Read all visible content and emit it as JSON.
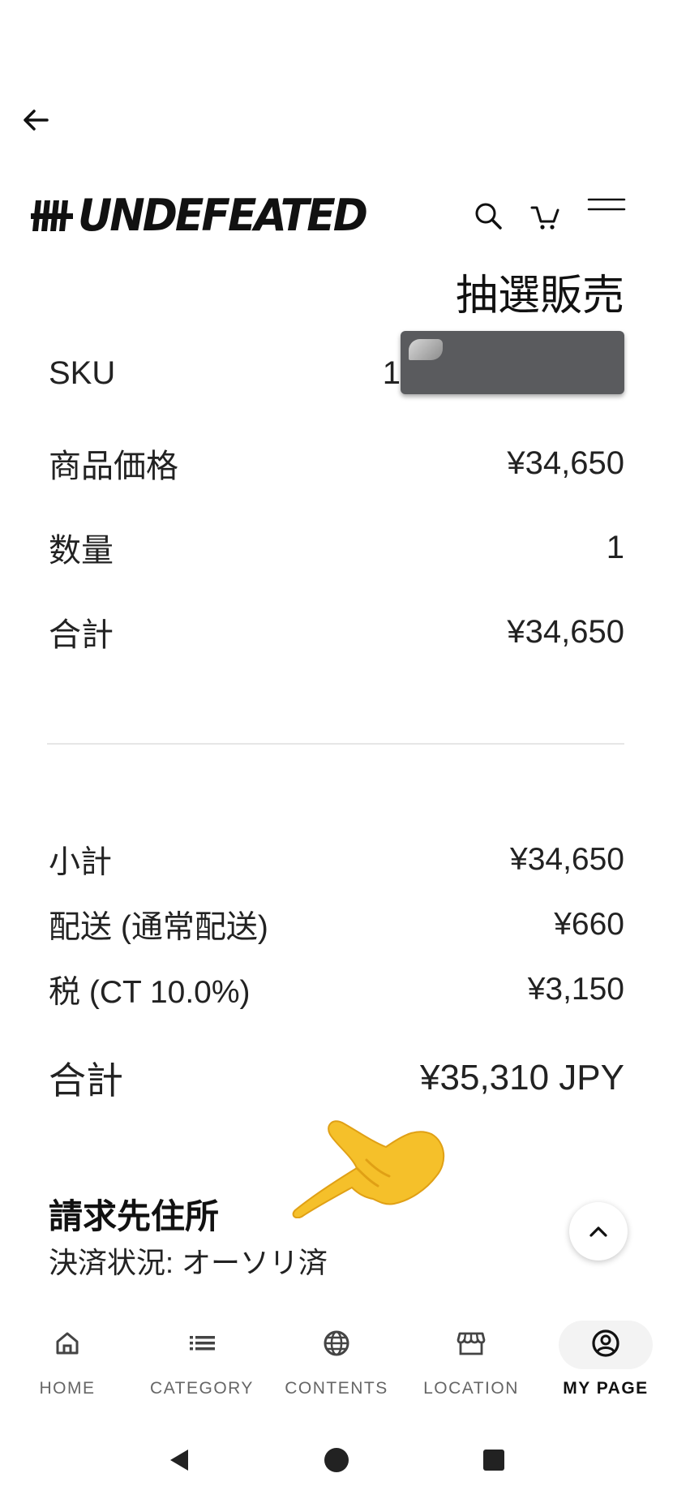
{
  "brand": {
    "logo_text": "UNDEFEATED"
  },
  "product": {
    "title": "抽選販売"
  },
  "details": [
    {
      "key": "SKU",
      "value": "1"
    },
    {
      "key": "商品価格",
      "value": "¥34,650"
    },
    {
      "key": "数量",
      "value": "1"
    },
    {
      "key": "合計",
      "value": "¥34,650"
    }
  ],
  "summary": [
    {
      "key": "小計",
      "value": "¥34,650"
    },
    {
      "key": "配送 (通常配送)",
      "value": "¥660"
    },
    {
      "key": "税 (CT 10.0%)",
      "value": "¥3,150"
    }
  ],
  "grand_total": {
    "key": "合計",
    "value": "¥35,310 JPY"
  },
  "billing": {
    "title": "請求先住所",
    "status": "決済状況: オーソリ済"
  },
  "bottom_nav": [
    {
      "label": "HOME",
      "icon": "home-icon"
    },
    {
      "label": "CATEGORY",
      "icon": "list-icon"
    },
    {
      "label": "CONTENTS",
      "icon": "globe-icon"
    },
    {
      "label": "LOCATION",
      "icon": "store-icon"
    },
    {
      "label": "MY PAGE",
      "icon": "user-circle-icon",
      "active": true
    }
  ],
  "colors": {
    "text": "#1a1a1a",
    "redaction": "#5a5b5e",
    "hand": "#f5c02a",
    "divider": "#e6e6e6"
  }
}
